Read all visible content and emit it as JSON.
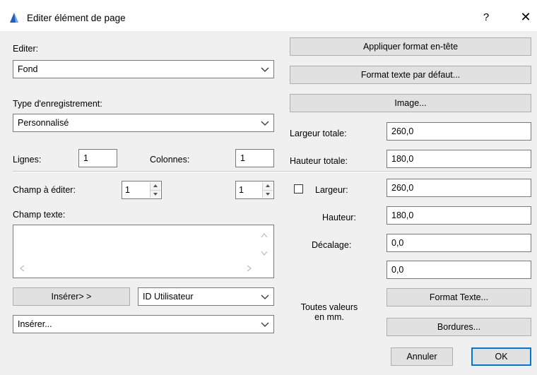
{
  "window": {
    "title": "Editer élément de page",
    "help": "?",
    "close": "✕"
  },
  "left": {
    "editer_label": "Editer:",
    "editer_value": "Fond",
    "type_label": "Type d'enregistrement:",
    "type_value": "Personnalisé",
    "lignes_label": "Lignes:",
    "lignes_value": "1",
    "colonnes_label": "Colonnes:",
    "colonnes_value": "1",
    "champ_edit_label": "Champ à éditer:",
    "champ_edit_value": "1",
    "champ_edit_value2": "1",
    "champ_texte_label": "Champ texte:",
    "inserer_button": "Insérer> >",
    "id_select_value": "ID Utilisateur",
    "inserer_select_value": "Insérer..."
  },
  "right": {
    "apply_header_button": "Appliquer format en-tête",
    "default_text_button": "Format texte par défaut...",
    "image_button": "Image...",
    "largeur_totale_label": "Largeur totale:",
    "largeur_totale_value": "260,0",
    "hauteur_totale_label": "Hauteur totale:",
    "hauteur_totale_value": "180,0",
    "largeur_label": "Largeur:",
    "largeur_value": "260,0",
    "hauteur_label": "Hauteur:",
    "hauteur_value": "180,0",
    "decalage_label": "Décalage:",
    "decalage_value1": "0,0",
    "decalage_value2": "0,0",
    "units_note_line1": "Toutes valeurs",
    "units_note_line2": "en mm.",
    "format_texte_button": "Format Texte...",
    "bordures_button": "Bordures..."
  },
  "footer": {
    "annuler_button": "Annuler",
    "ok_button": "OK"
  },
  "icons": {
    "app": "archicad-icon",
    "chevron": "chevron-down-icon"
  }
}
